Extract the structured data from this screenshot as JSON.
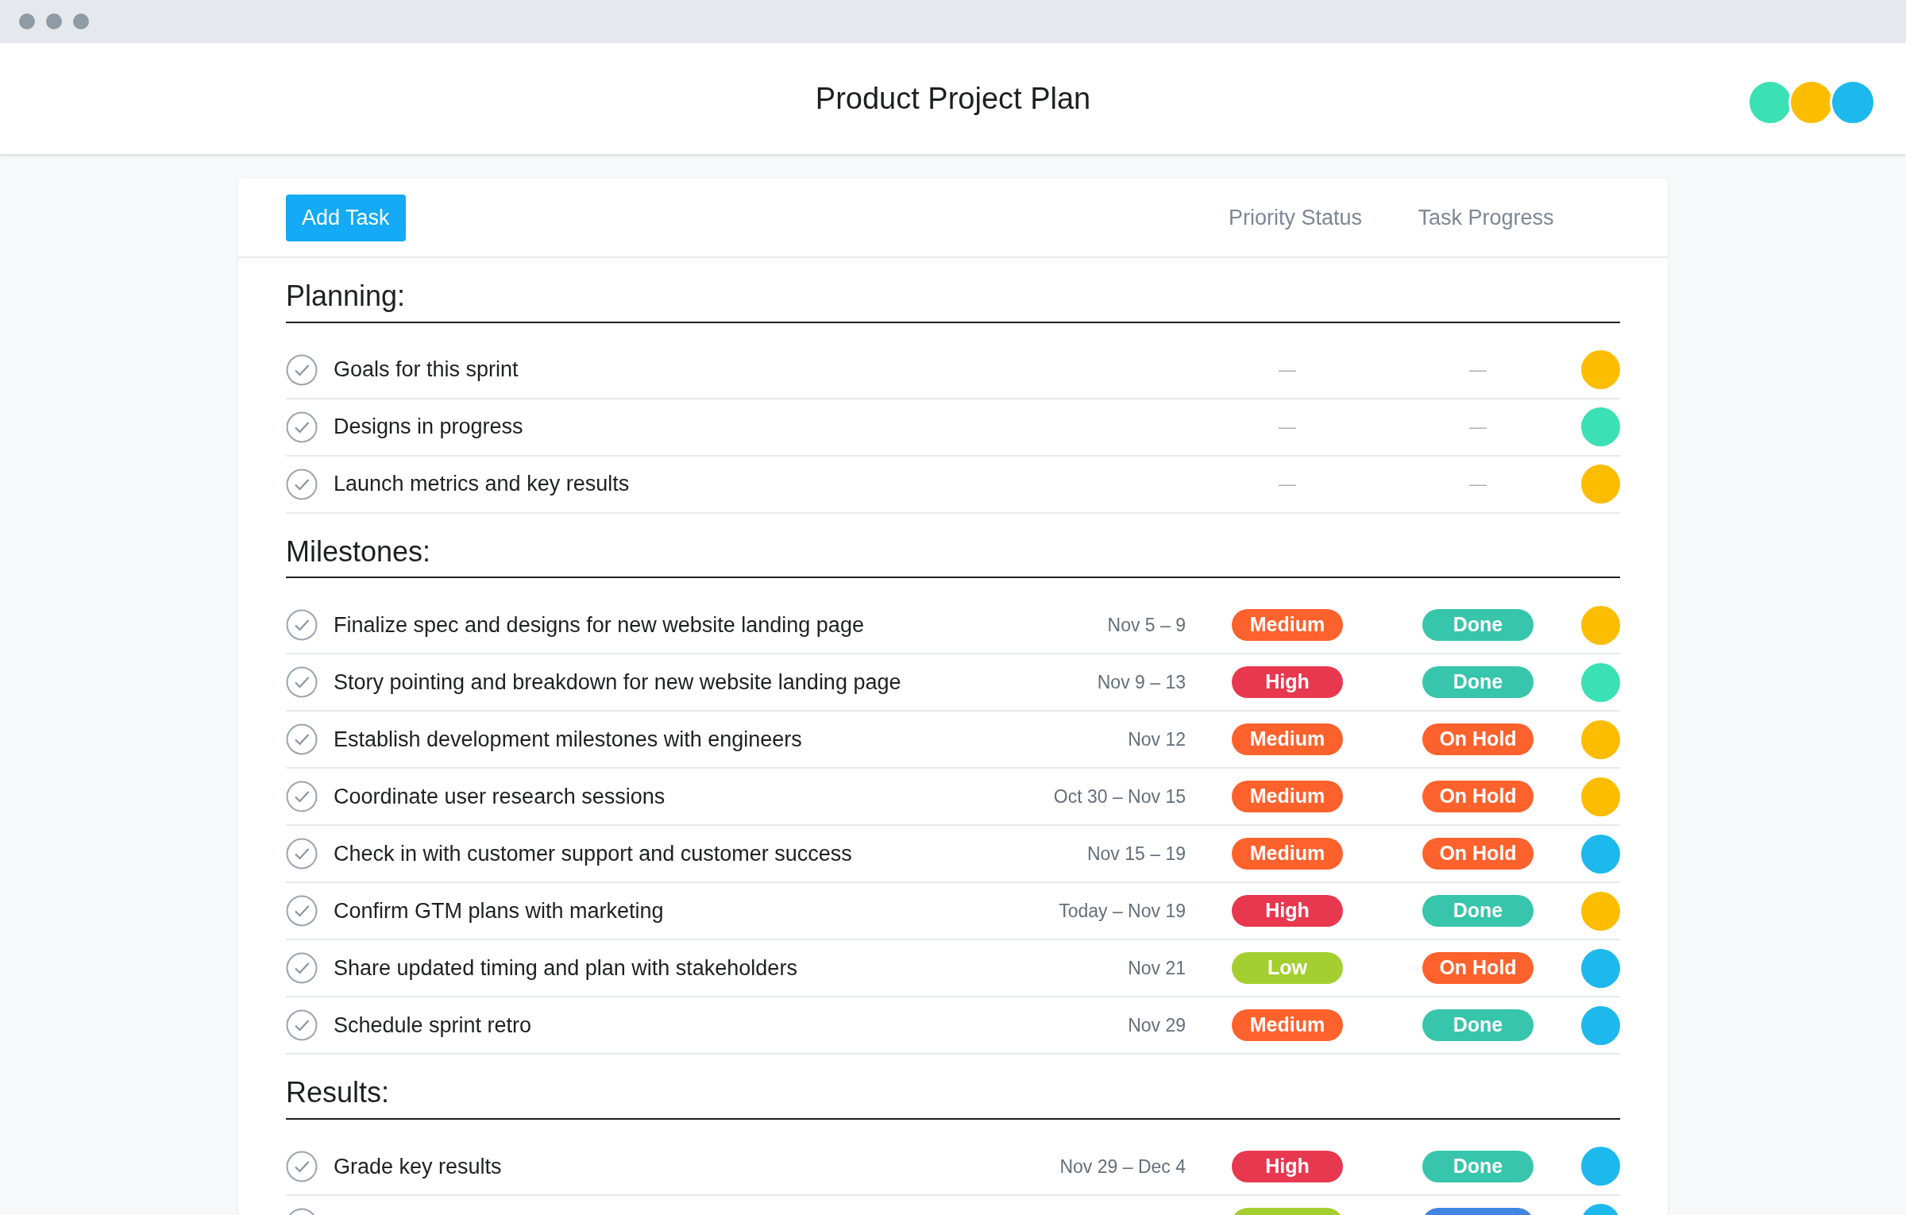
{
  "window": {
    "title": "Product Project Plan"
  },
  "members": [
    {
      "color": "#3be0b4"
    },
    {
      "color": "#fcbd01"
    },
    {
      "color": "#1db8ec"
    }
  ],
  "toolbar": {
    "add_button": "Add Task",
    "columns": [
      "Priority Status",
      "Task Progress"
    ]
  },
  "sections": [
    {
      "title": "Planning:",
      "tasks": [
        {
          "name": "Goals for this sprint",
          "priority": {
            "kind": "dash",
            "label": "—"
          },
          "progress": {
            "kind": "dash",
            "label": "—"
          },
          "assignee": {
            "color": "#fcbd01"
          }
        },
        {
          "name": "Designs in progress",
          "priority": {
            "kind": "dash",
            "label": "—"
          },
          "progress": {
            "kind": "dash",
            "label": "—"
          },
          "assignee": {
            "color": "#3be0b4"
          }
        },
        {
          "name": "Launch metrics and key results",
          "priority": {
            "kind": "dash",
            "label": "—"
          },
          "progress": {
            "kind": "dash",
            "label": "—"
          },
          "assignee": {
            "color": "#fcbd01"
          }
        }
      ]
    },
    {
      "title": "Milestones:",
      "tasks": [
        {
          "name": "Finalize spec and designs for new website landing page",
          "dates": "Nov 5 – 9",
          "priority": {
            "kind": "badge",
            "label": "Medium",
            "color": "#fd612c"
          },
          "progress": {
            "kind": "badge",
            "label": "Done",
            "color": "#37c5ab"
          },
          "assignee": {
            "color": "#fcbd01"
          }
        },
        {
          "name": "Story pointing and breakdown for new website landing page",
          "dates": "Nov 9 – 13",
          "priority": {
            "kind": "badge",
            "label": "High",
            "color": "#e8384f"
          },
          "progress": {
            "kind": "badge",
            "label": "Done",
            "color": "#37c5ab"
          },
          "assignee": {
            "color": "#3be0b4"
          }
        },
        {
          "name": "Establish development milestones with engineers",
          "dates": "Nov 12",
          "priority": {
            "kind": "badge",
            "label": "Medium",
            "color": "#fd612c"
          },
          "progress": {
            "kind": "badge",
            "label": "On Hold",
            "color": "#fd612c"
          },
          "assignee": {
            "color": "#fcbd01"
          }
        },
        {
          "name": "Coordinate user research sessions",
          "dates": "Oct 30 – Nov 15",
          "priority": {
            "kind": "badge",
            "label": "Medium",
            "color": "#fd612c"
          },
          "progress": {
            "kind": "badge",
            "label": "On Hold",
            "color": "#fd612c"
          },
          "assignee": {
            "color": "#fcbd01"
          }
        },
        {
          "name": "Check in with customer support and customer success",
          "dates": "Nov 15 – 19",
          "priority": {
            "kind": "badge",
            "label": "Medium",
            "color": "#fd612c"
          },
          "progress": {
            "kind": "badge",
            "label": "On Hold",
            "color": "#fd612c"
          },
          "assignee": {
            "color": "#1db8ec"
          }
        },
        {
          "name": "Confirm GTM plans with marketing",
          "dates": "Today – Nov 19",
          "priority": {
            "kind": "badge",
            "label": "High",
            "color": "#e8384f"
          },
          "progress": {
            "kind": "badge",
            "label": "Done",
            "color": "#37c5ab"
          },
          "assignee": {
            "color": "#fcbd01"
          }
        },
        {
          "name": "Share updated timing and plan with stakeholders",
          "dates": "Nov 21",
          "priority": {
            "kind": "badge",
            "label": "Low",
            "color": "#a4cf30"
          },
          "progress": {
            "kind": "badge",
            "label": "On Hold",
            "color": "#fd612c"
          },
          "assignee": {
            "color": "#1db8ec"
          }
        },
        {
          "name": "Schedule sprint retro",
          "dates": "Nov 29",
          "priority": {
            "kind": "badge",
            "label": "Medium",
            "color": "#fd612c"
          },
          "progress": {
            "kind": "badge",
            "label": "Done",
            "color": "#37c5ab"
          },
          "assignee": {
            "color": "#1db8ec"
          }
        }
      ]
    },
    {
      "title": "Results:",
      "tasks": [
        {
          "name": "Grade key results",
          "dates": "Nov 29 – Dec 4",
          "priority": {
            "kind": "badge",
            "label": "High",
            "color": "#e8384f"
          },
          "progress": {
            "kind": "badge",
            "label": "Done",
            "color": "#37c5ab"
          },
          "assignee": {
            "color": "#1db8ec"
          }
        },
        {
          "priority": {
            "kind": "badge",
            "color": "#a4cf30"
          },
          "progress": {
            "kind": "badge",
            "color": "#4186e0"
          },
          "assignee": {
            "color": "#1db8ec"
          }
        }
      ]
    }
  ]
}
